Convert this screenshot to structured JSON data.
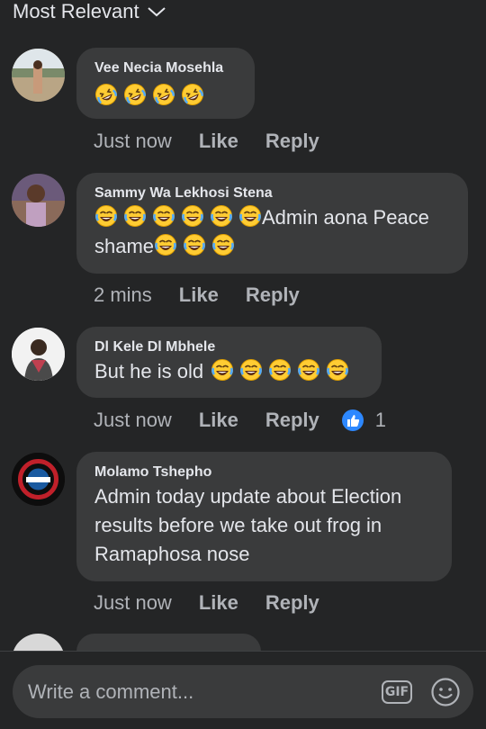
{
  "sort": {
    "label": "Most Relevant"
  },
  "comments": [
    {
      "author": "Vee Necia Mosehla",
      "text_prefix": "",
      "emojis_line1": [
        "rofl-emoji",
        "rofl-emoji",
        "rofl-emoji",
        "rofl-emoji"
      ],
      "time": "Just now",
      "like": "Like",
      "reply": "Reply"
    },
    {
      "author": "Sammy Wa Lekhosi Stena",
      "text_line1": "Admin aona Peace",
      "text_line2": "shame",
      "time": "2 mins",
      "like": "Like",
      "reply": "Reply"
    },
    {
      "author": "Dl Kele Dl Mbhele",
      "text_line1": "But he is old",
      "time": "Just now",
      "like": "Like",
      "reply": "Reply",
      "reaction_count": "1"
    },
    {
      "author": "Molamo Tshepho",
      "text_line1": "Admin today update about Election",
      "text_line2": "results before we take out frog in",
      "text_line3": "Ramaphosa nose",
      "time": "Just now",
      "like": "Like",
      "reply": "Reply"
    }
  ],
  "composer": {
    "placeholder": "Write a comment...",
    "gif_label": "GIF"
  },
  "colors": {
    "background": "#242526",
    "bubble": "#3a3b3c",
    "text": "#e4e6eb",
    "secondary": "#b0b3b8",
    "like_blue": "#2d88ff"
  }
}
